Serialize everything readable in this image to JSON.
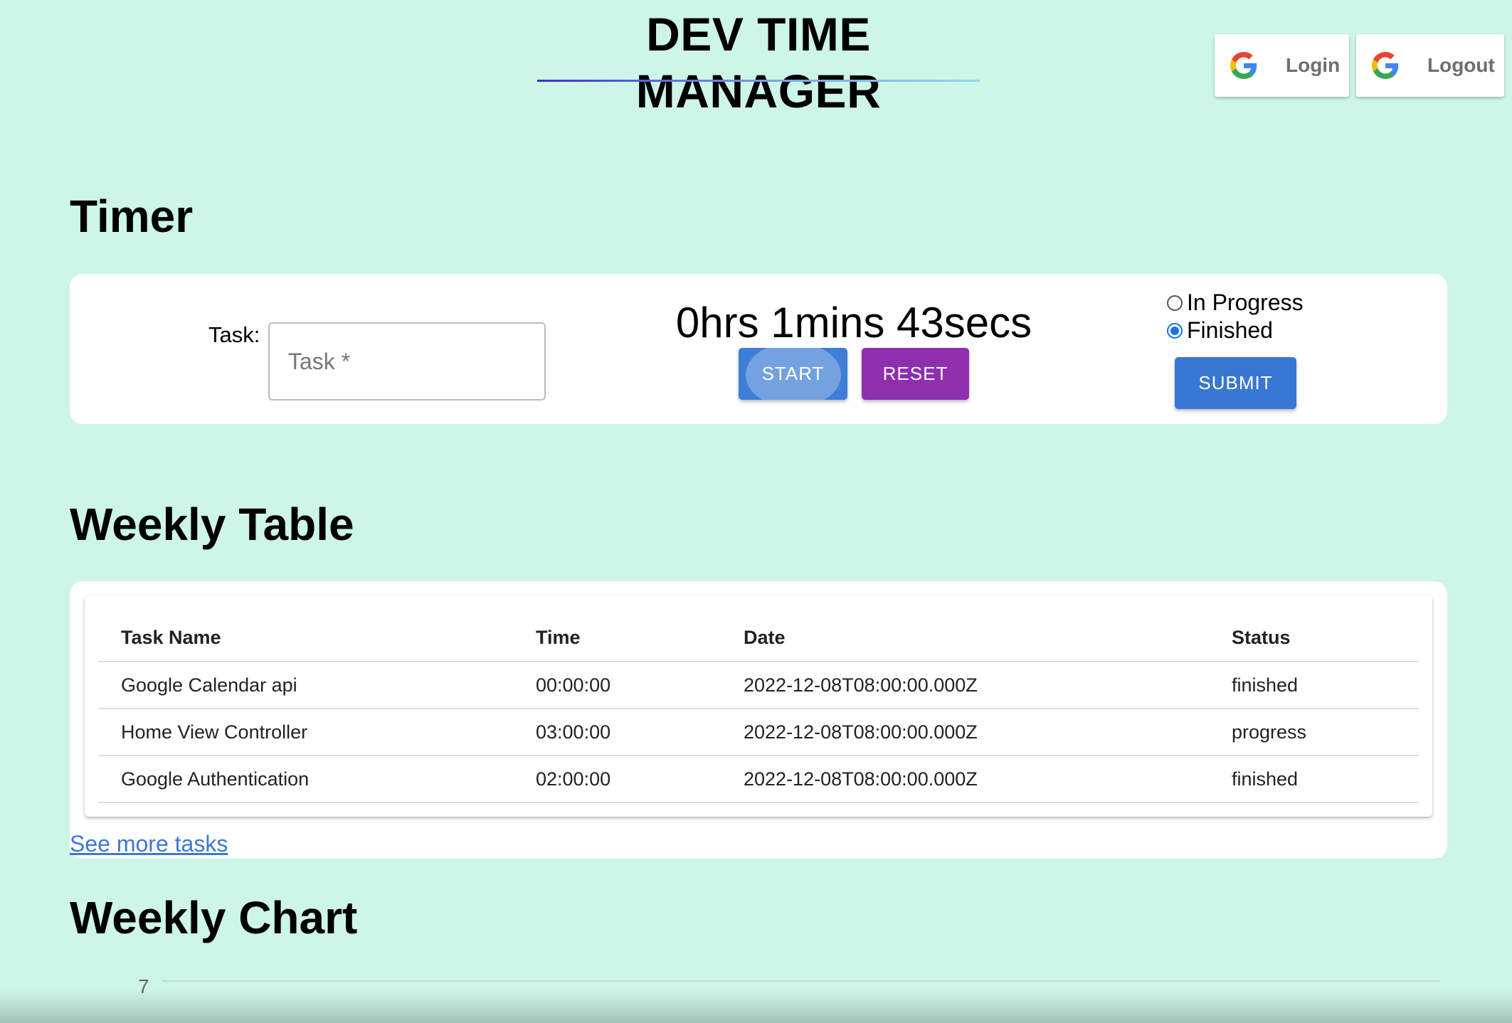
{
  "header": {
    "app_title": "DEV TIME MANAGER",
    "login_label": "Login",
    "logout_label": "Logout"
  },
  "timer": {
    "heading": "Timer",
    "task_label": "Task:",
    "task_placeholder": "Task *",
    "task_value": "",
    "display": "0hrs 1mins 43secs",
    "start_label": "START",
    "reset_label": "RESET",
    "submit_label": "SUBMIT",
    "status_options": [
      {
        "label": "In Progress",
        "checked": false
      },
      {
        "label": "Finished",
        "checked": true
      }
    ]
  },
  "weekly_table": {
    "heading": "Weekly Table",
    "columns": [
      "Task Name",
      "Time",
      "Date",
      "Status"
    ],
    "rows": [
      [
        "Google Calendar api",
        "00:00:00",
        "2022-12-08T08:00:00.000Z",
        "finished"
      ],
      [
        "Home View Controller",
        "03:00:00",
        "2022-12-08T08:00:00.000Z",
        "progress"
      ],
      [
        "Google Authentication",
        "02:00:00",
        "2022-12-08T08:00:00.000Z",
        "finished"
      ]
    ],
    "see_more_label": "See more tasks"
  },
  "weekly_chart": {
    "heading": "Weekly Chart",
    "visible_tick": "7"
  },
  "colors": {
    "background": "#cdf5e8",
    "start_button": "#3f7ed6",
    "reset_button": "#8e2fae",
    "submit_button": "#3977d4",
    "link": "#3c78d8"
  },
  "icons": {
    "auth_icon": "google-g-icon"
  }
}
